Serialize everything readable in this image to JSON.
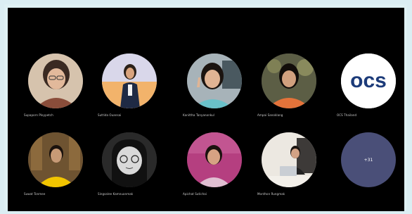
{
  "participants": [
    {
      "name": "Supaporn Ploypetch",
      "avatar": "photo-woman-glasses",
      "bg": "#c9a88a"
    },
    {
      "name": "Suttida Ouansai",
      "avatar": "photo-woman-suit",
      "bg": "#d8d6e8"
    },
    {
      "name": "Kanittha Tanyanonkul",
      "avatar": "photo-woman-peace",
      "bg": "#9aa9b2"
    },
    {
      "name": "Ampai Sanoklang",
      "avatar": "photo-woman-orange",
      "bg": "#6c6a4f"
    },
    {
      "name": "OCS Thailand",
      "avatar": "ocs-logo",
      "bg": "#ffffff",
      "logo_text": "ocs"
    },
    {
      "name": "Suwat Tonmee",
      "avatar": "photo-man-bookshelf",
      "bg": "#7a5b35"
    },
    {
      "name": "Singsalee Kamnuanmak",
      "avatar": "cartoon-woman-glasses",
      "bg": "#2b2b2b"
    },
    {
      "name": "Apichat Sutichai",
      "avatar": "photo-woman-pink",
      "bg": "#b13e7c"
    },
    {
      "name": "Monthon Rungmak",
      "avatar": "photo-man-laptop",
      "bg": "#e8e4dd"
    }
  ],
  "overflow": {
    "label": "+31"
  }
}
